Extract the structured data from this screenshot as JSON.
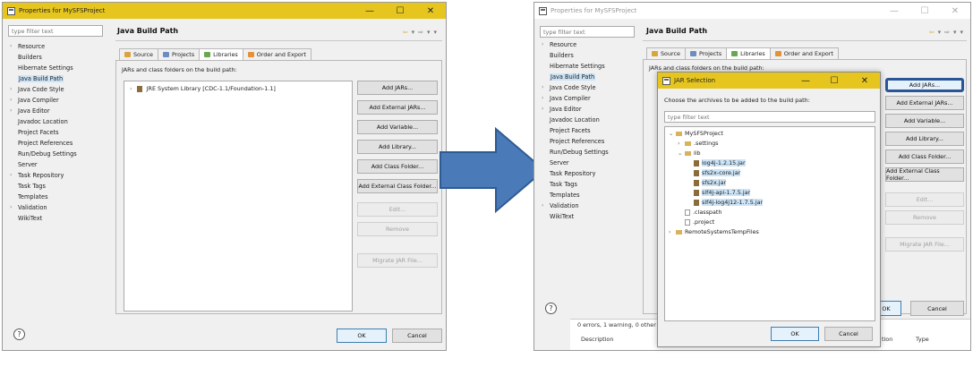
{
  "left": {
    "title": "Properties for MySFSProject",
    "window_buttons": {
      "min": "—",
      "max": "☐",
      "close": "✕"
    },
    "filter_placeholder": "type filter text",
    "nav": [
      {
        "label": "Resource",
        "chevron": true
      },
      {
        "label": "Builders",
        "chevron": false
      },
      {
        "label": "Hibernate Settings",
        "chevron": false
      },
      {
        "label": "Java Build Path",
        "chevron": false,
        "selected": true
      },
      {
        "label": "Java Code Style",
        "chevron": true
      },
      {
        "label": "Java Compiler",
        "chevron": true
      },
      {
        "label": "Java Editor",
        "chevron": true
      },
      {
        "label": "Javadoc Location",
        "chevron": false
      },
      {
        "label": "Project Facets",
        "chevron": false
      },
      {
        "label": "Project References",
        "chevron": false
      },
      {
        "label": "Run/Debug Settings",
        "chevron": false
      },
      {
        "label": "Server",
        "chevron": false
      },
      {
        "label": "Task Repository",
        "chevron": true
      },
      {
        "label": "Task Tags",
        "chevron": false
      },
      {
        "label": "Templates",
        "chevron": false
      },
      {
        "label": "Validation",
        "chevron": true
      },
      {
        "label": "WikiText",
        "chevron": false
      }
    ],
    "page_title": "Java Build Path",
    "tabs": [
      "Source",
      "Projects",
      "Libraries",
      "Order and Export"
    ],
    "jars_label": "JARs and class folders on the build path:",
    "tree_item": "JRE System Library [CDC-1.1/Foundation-1.1]",
    "buttons": [
      {
        "label": "Add JARs...",
        "enabled": true
      },
      {
        "label": "Add External JARs...",
        "enabled": true
      },
      {
        "label": "Add Variable...",
        "enabled": true
      },
      {
        "label": "Add Library...",
        "enabled": true
      },
      {
        "label": "Add Class Folder...",
        "enabled": true
      },
      {
        "label": "Add External Class Folder...",
        "enabled": true
      },
      {
        "label": "Edit...",
        "enabled": false
      },
      {
        "label": "Remove",
        "enabled": false
      },
      {
        "label": "Migrate JAR File...",
        "enabled": false
      }
    ],
    "ok": "OK",
    "cancel": "Cancel",
    "help": "?"
  },
  "right": {
    "title": "Properties for MySFSProject",
    "filter_placeholder": "type filter text",
    "nav": [
      {
        "label": "Resource",
        "chevron": true
      },
      {
        "label": "Builders",
        "chevron": false
      },
      {
        "label": "Hibernate Settings",
        "chevron": false
      },
      {
        "label": "Java Build Path",
        "chevron": false,
        "selected": true
      },
      {
        "label": "Java Code Style",
        "chevron": true
      },
      {
        "label": "Java Compiler",
        "chevron": true
      },
      {
        "label": "Java Editor",
        "chevron": true
      },
      {
        "label": "Javadoc Location",
        "chevron": false
      },
      {
        "label": "Project Facets",
        "chevron": false
      },
      {
        "label": "Project References",
        "chevron": false
      },
      {
        "label": "Run/Debug Settings",
        "chevron": false
      },
      {
        "label": "Server",
        "chevron": false
      },
      {
        "label": "Task Repository",
        "chevron": false
      },
      {
        "label": "Task Tags",
        "chevron": false
      },
      {
        "label": "Templates",
        "chevron": false
      },
      {
        "label": "Validation",
        "chevron": true
      },
      {
        "label": "WikiText",
        "chevron": false
      }
    ],
    "page_title": "Java Build Path",
    "tabs": [
      "Source",
      "Projects",
      "Libraries",
      "Order and Export"
    ],
    "jars_label": "JARs and class folders on the build path:",
    "buttons": [
      {
        "label": "Add JARs...",
        "enabled": true,
        "highlight": true
      },
      {
        "label": "Add External JARs...",
        "enabled": true
      },
      {
        "label": "Add Variable...",
        "enabled": true
      },
      {
        "label": "Add Library...",
        "enabled": true
      },
      {
        "label": "Add Class Folder...",
        "enabled": true
      },
      {
        "label": "Add External Class Folder...",
        "enabled": true
      },
      {
        "label": "Edit...",
        "enabled": false
      },
      {
        "label": "Remove",
        "enabled": false
      },
      {
        "label": "Migrate JAR File...",
        "enabled": false
      }
    ],
    "ok": "OK",
    "cancel": "Cancel",
    "status_text": "0 errors, 1 warning, 0 other",
    "col_description": "Description",
    "col_location": "tion",
    "col_type": "Type"
  },
  "dialog": {
    "title": "JAR Selection",
    "prompt": "Choose the archives to be added to the build path:",
    "filter_placeholder": "type filter text",
    "tree": [
      {
        "label": "MySFSProject",
        "indent": 0,
        "toggle": "⌄",
        "icon": "folder"
      },
      {
        "label": ".settings",
        "indent": 1,
        "toggle": "›",
        "icon": "folder"
      },
      {
        "label": "lib",
        "indent": 1,
        "toggle": "⌄",
        "icon": "folder"
      },
      {
        "label": "log4j-1.2.15.jar",
        "indent": 2,
        "toggle": "",
        "icon": "jar",
        "selected": true
      },
      {
        "label": "sfs2x-core.jar",
        "indent": 2,
        "toggle": "",
        "icon": "jar",
        "selected": true
      },
      {
        "label": "sfs2x.jar",
        "indent": 2,
        "toggle": "",
        "icon": "jar",
        "selected": true
      },
      {
        "label": "slf4j-api-1.7.5.jar",
        "indent": 2,
        "toggle": "",
        "icon": "jar",
        "selected": true
      },
      {
        "label": "slf4j-log4j12-1.7.5.jar",
        "indent": 2,
        "toggle": "",
        "icon": "jar",
        "selected": true
      },
      {
        "label": ".classpath",
        "indent": 1,
        "toggle": "",
        "icon": "file"
      },
      {
        "label": ".project",
        "indent": 1,
        "toggle": "",
        "icon": "file"
      },
      {
        "label": "RemoteSystemsTempFiles",
        "indent": 0,
        "toggle": "›",
        "icon": "folder"
      }
    ],
    "ok": "OK",
    "cancel": "Cancel"
  },
  "arrow_color": "#4a7ab8"
}
